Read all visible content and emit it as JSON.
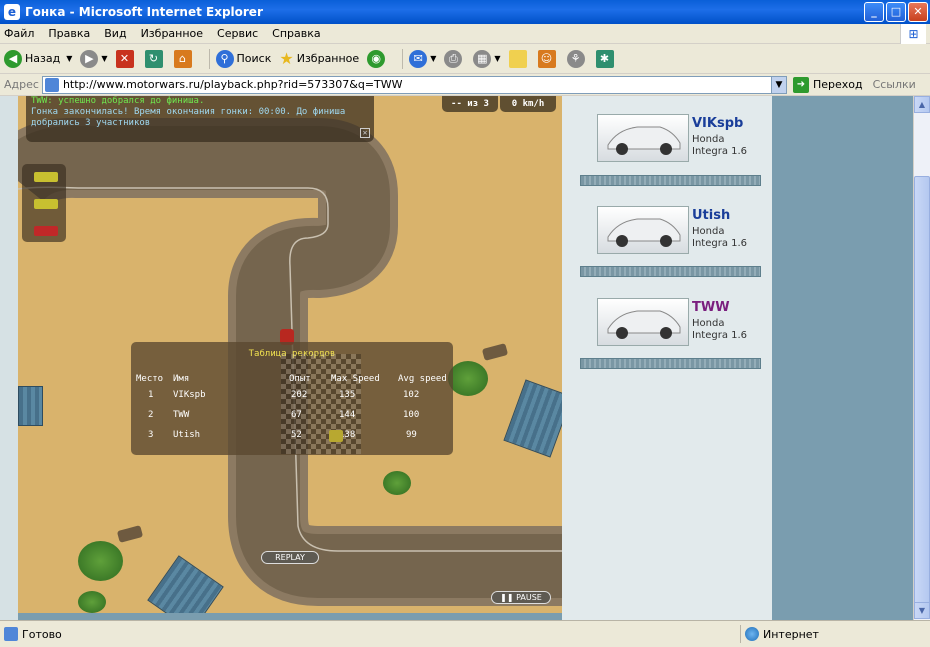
{
  "window": {
    "title": "Гонка - Microsoft Internet Explorer"
  },
  "menu": [
    "Файл",
    "Правка",
    "Вид",
    "Избранное",
    "Сервис",
    "Справка"
  ],
  "toolbar": {
    "back": "Назад",
    "search": "Поиск",
    "favorites": "Избранное"
  },
  "address": {
    "label": "Адрес",
    "url": "http://www.motorwars.ru/playback.php?rid=573307&q=TWW",
    "go": "Переход",
    "links": "Ссылки"
  },
  "game": {
    "messages": [
      "TWW: успешно добрался до финиша.",
      "Гонка закончилась! Время окончания гонки: 00:00. До финиша",
      "добрались 3 участников"
    ],
    "hud_position": "-- из 3",
    "hud_speed": "0 km/h",
    "records": {
      "title": "Таблица рекордов",
      "headers": [
        "Место",
        "Имя",
        "Опыт",
        "Max Speed",
        "Avg speed"
      ],
      "rows": [
        [
          "1",
          "VIKspb",
          "202",
          "135",
          "102"
        ],
        [
          "2",
          "TWW",
          "67",
          "144",
          "100"
        ],
        [
          "3",
          "Utish",
          "52",
          "138",
          "99"
        ]
      ]
    },
    "replay": "REPLAY",
    "pause": "PAUSE"
  },
  "players": [
    {
      "name": "VIKspb",
      "car1": "Honda",
      "car2": "Integra 1.6"
    },
    {
      "name": "Utish",
      "car1": "Honda",
      "car2": "Integra 1.6"
    },
    {
      "name": "TWW",
      "car1": "Honda",
      "car2": "Integra 1.6"
    }
  ],
  "status": {
    "text": "Готово",
    "zone": "Интернет"
  }
}
